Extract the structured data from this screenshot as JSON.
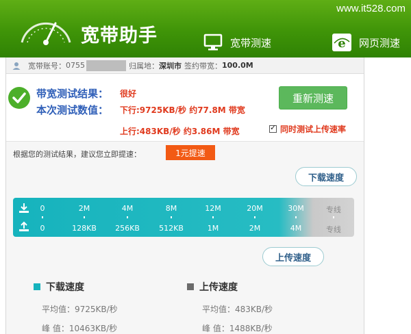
{
  "header": {
    "app_title": "宽带助手",
    "site_mark": "www.it528.com",
    "nav": [
      {
        "label": "宽带测速",
        "icon": "monitor-icon"
      },
      {
        "label": "网页测速",
        "icon": "ie-icon"
      }
    ]
  },
  "account": {
    "account_label": "宽带账号：",
    "account_prefix": "0755",
    "region_label": "归属地：",
    "region_value": "深圳市",
    "plan_label": "签约带宽：",
    "plan_value": "100.0M"
  },
  "result": {
    "label_result": "带宽测试结果：",
    "label_value": "本次测试数值：",
    "rating": "很好",
    "download_line": "下行:9725KB/秒 约77.8M 带宽",
    "upload_line": "上行:483KB/秒 约3.86M 带宽",
    "retest_label": "重新测速",
    "sim_upload_label": "同时测试上传速率"
  },
  "suggestion": {
    "text": "根据您的测试结果，建议您立即提速：",
    "boost_label": "1元提速"
  },
  "speed_gauge": {
    "download_bubble": "下载速度",
    "upload_bubble": "上传速度",
    "download_ticks": [
      "0",
      "2M",
      "4M",
      "8M",
      "12M",
      "20M",
      "30M",
      "专线"
    ],
    "upload_ticks": [
      "0",
      "128KB",
      "256KB",
      "512KB",
      "1M",
      "2M",
      "4M",
      "专线"
    ]
  },
  "stats": {
    "download": {
      "title": "下载速度",
      "avg": "平均值：9725KB/秒",
      "peak": "峰  值：10463KB/秒"
    },
    "upload": {
      "title": "上传速度",
      "avg": "平均值：483KB/秒",
      "peak": "峰  值：1488KB/秒"
    }
  },
  "colors": {
    "header_green": "#3f9408",
    "accent_teal": "#16b3bd",
    "result_red": "#e03a1e",
    "label_blue": "#2f5fb8",
    "retest_green": "#5cb85c",
    "boost_orange": "#f25a14",
    "upload_gray": "#6b6b6b"
  }
}
